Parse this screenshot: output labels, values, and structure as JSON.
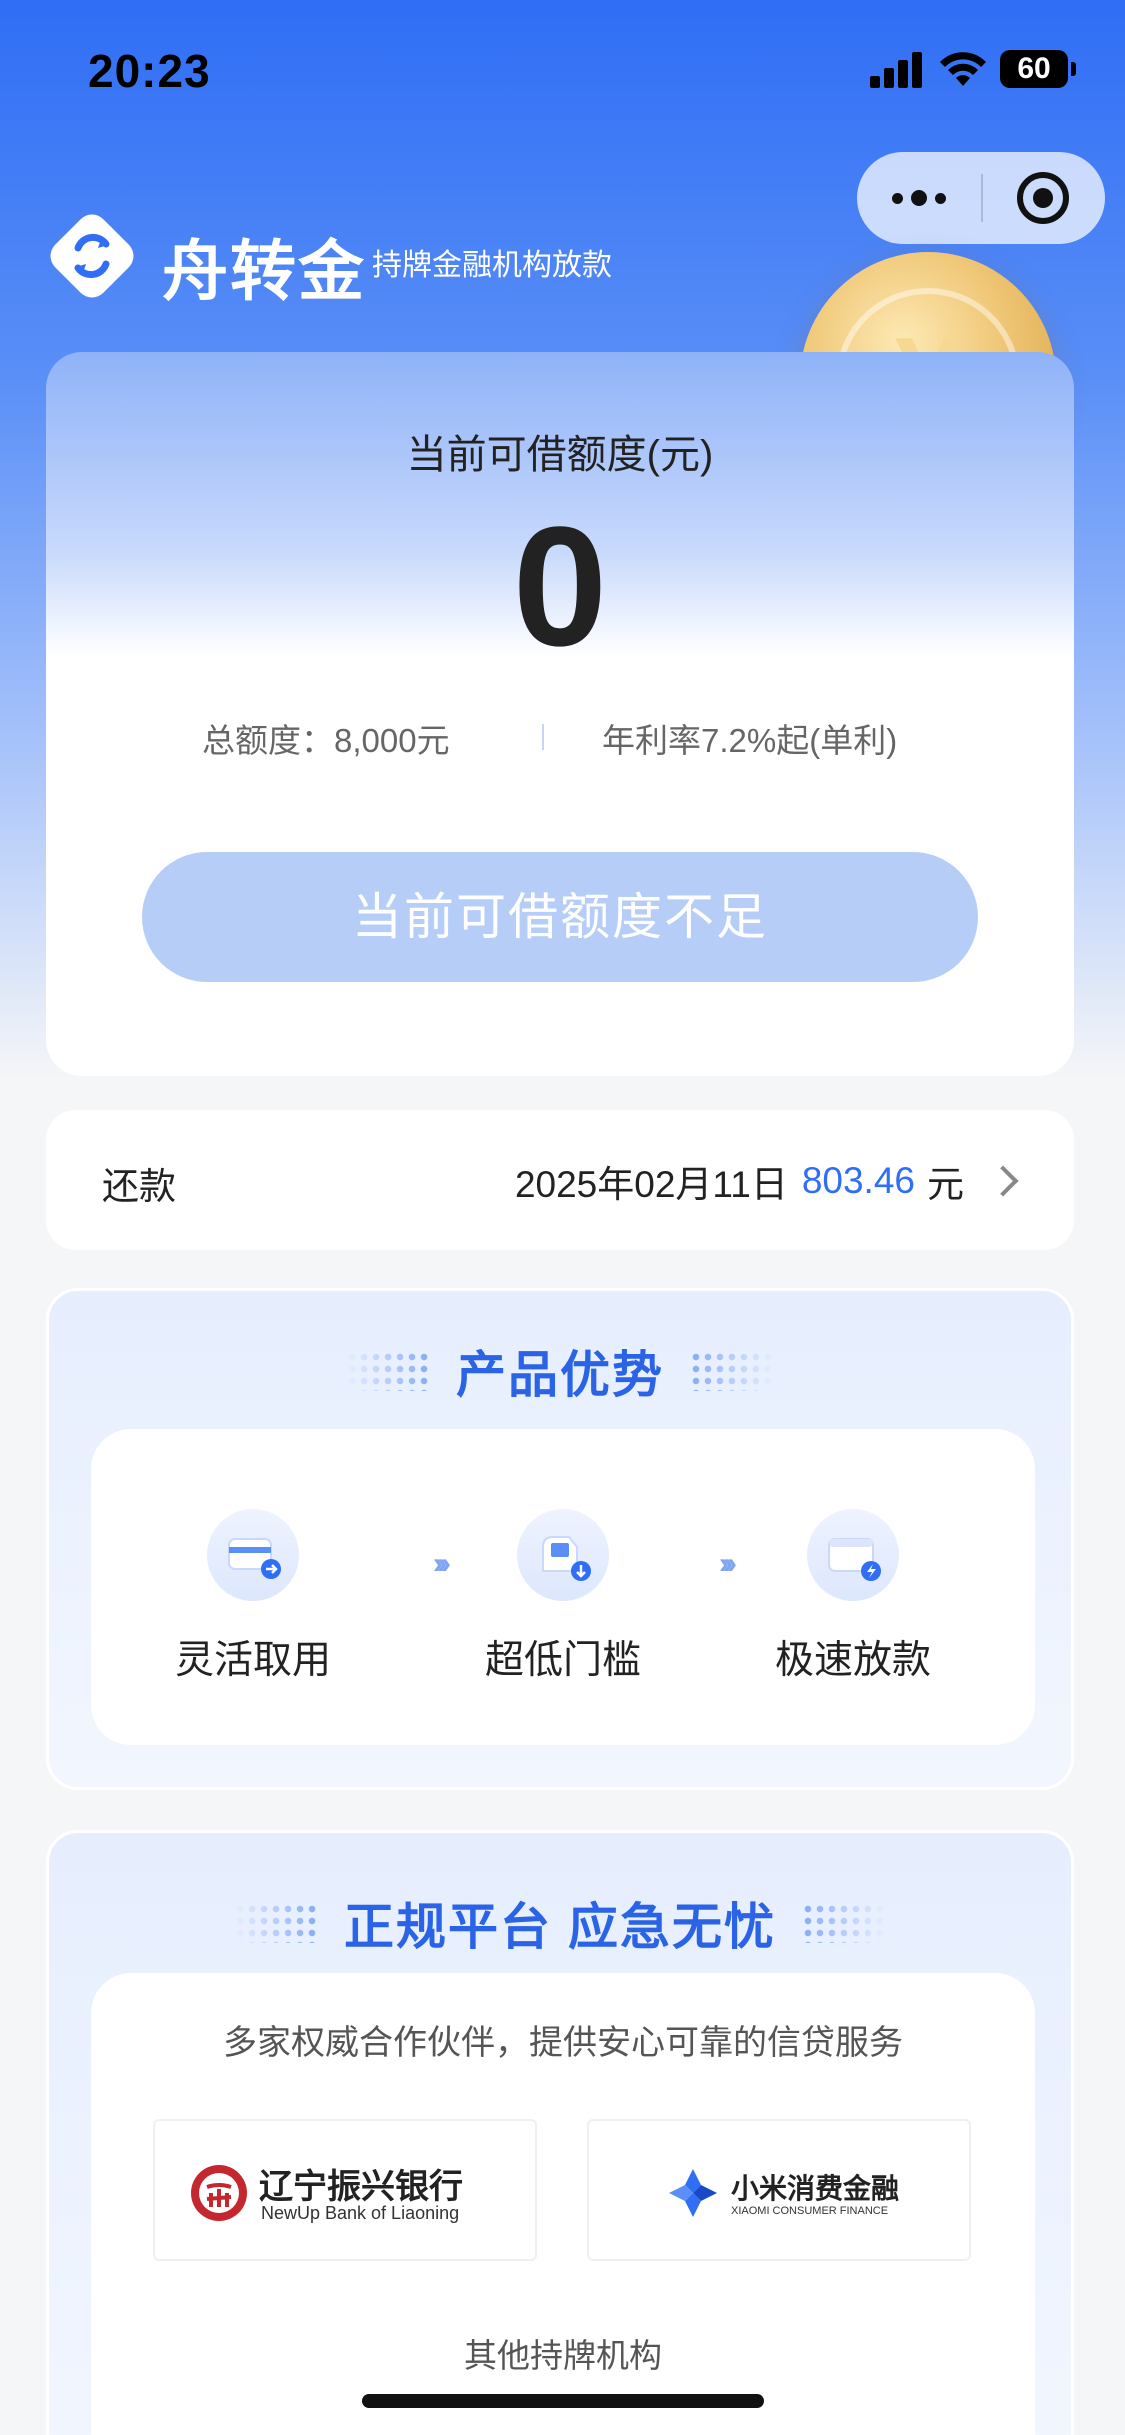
{
  "status_bar": {
    "time": "20:23",
    "battery": "60"
  },
  "brand": {
    "name": "舟转金",
    "tagline": "持牌金融机构放款"
  },
  "coin_symbol": "¥",
  "credit": {
    "label": "当前可借额度(元)",
    "amount": "0",
    "total_limit": "总额度：8,000元",
    "rate": "年利率7.2%起(单利)",
    "button_label": "当前可借额度不足"
  },
  "repayment": {
    "label": "还款",
    "date": "2025年02月11日",
    "amount": "803.46",
    "unit": "元"
  },
  "advantages": {
    "title": "产品优势",
    "items": [
      {
        "label": "灵活取用",
        "icon": "card-transfer-icon"
      },
      {
        "label": "超低门槛",
        "icon": "low-threshold-icon"
      },
      {
        "label": "极速放款",
        "icon": "wallet-fast-icon"
      }
    ]
  },
  "platform": {
    "title": "正规平台 应急无忧",
    "subtitle": "多家权威合作伙伴，提供安心可靠的信贷服务",
    "partners": [
      {
        "name_cn": "辽宁振兴银行",
        "name_en": "NewUp Bank of Liaoning"
      },
      {
        "name_cn": "小米消费金融",
        "name_en": "XIAOMI CONSUMER FINANCE"
      }
    ],
    "other_label": "其他持牌机构"
  },
  "colors": {
    "primary": "#2f6ef5",
    "button_disabled": "#b6cdf8",
    "title_blue": "#2b63e6"
  }
}
